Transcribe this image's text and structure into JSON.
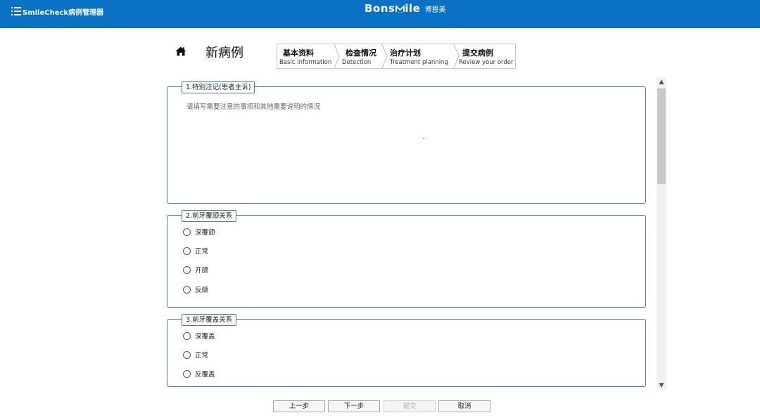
{
  "header": {
    "app_title": "SmileCheck病例管理器",
    "brand_latin_prefix": "Bons",
    "brand_latin_suffix": "ile",
    "brand_cn": "博恩美",
    "bg_color": "#0a72c4"
  },
  "page": {
    "title": "新病例",
    "home_icon": "home-icon"
  },
  "steps": [
    {
      "cn": "基本资料",
      "en": "Basic information"
    },
    {
      "cn": "检查情况",
      "en": "Detection"
    },
    {
      "cn": "治疗计划",
      "en": "Treatment planning"
    },
    {
      "cn": "提交病例",
      "en": "Review your order"
    }
  ],
  "sections": {
    "notes": {
      "legend": "1.特别注记(患者主诉)",
      "placeholder": "请填写需要注意的事项和其他需要说明的情况"
    },
    "overbite": {
      "legend": "2.前牙覆颌关系",
      "options": [
        "深覆颌",
        "正常",
        "开颌",
        "反颌"
      ]
    },
    "overjet": {
      "legend": "3.前牙覆盖关系",
      "options": [
        "深覆盖",
        "正常",
        "反覆盖"
      ]
    }
  },
  "buttons": {
    "prev": "上一步",
    "next": "下一步",
    "submit": "提交",
    "cancel": "取消"
  },
  "colors": {
    "accent": "#3a7fc0",
    "disabled_text": "#b5b5b5"
  }
}
